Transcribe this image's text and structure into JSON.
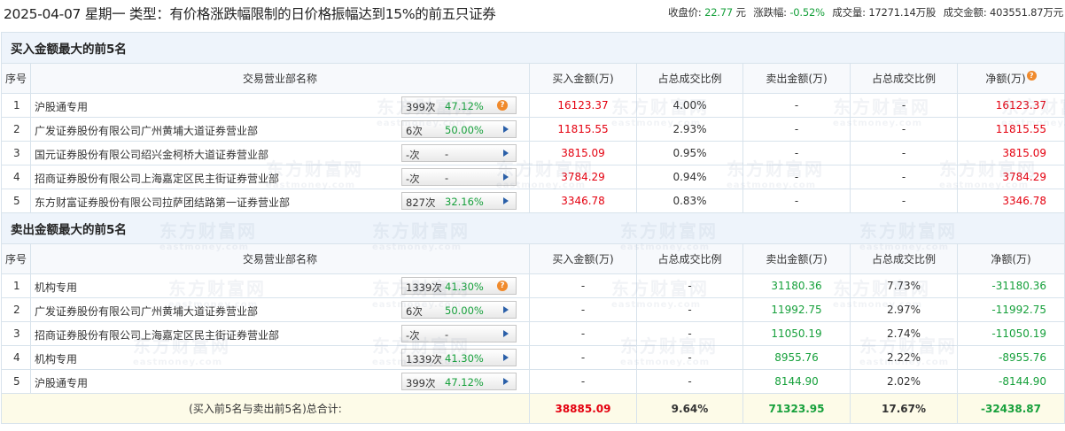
{
  "header": {
    "title": "2025-04-07 星期一 类型：有价格涨跌幅限制的日价格振幅达到15%的前五只证券",
    "close_label": "收盘价:",
    "close_value": "22.77",
    "close_unit": "元",
    "change_label": "涨跌幅:",
    "change_value": "-0.52%",
    "volume_label": "成交量:",
    "volume_value": "17271.14万股",
    "amount_label": "成交金额:",
    "amount_value": "403551.87万元"
  },
  "buy_section": {
    "title": "买入金额最大的前5名",
    "columns": [
      "序号",
      "交易营业部名称",
      "买入金额(万)",
      "占总成交比例",
      "卖出金额(万)",
      "占总成交比例",
      "净额(万)"
    ],
    "rows": [
      {
        "idx": "1",
        "name": "沪股通专用",
        "count": "399次",
        "pct": "47.12%",
        "buy": "16123.37",
        "buy_ratio": "4.00%",
        "sell": "-",
        "sell_ratio": "-",
        "net": "16123.37",
        "icon": "question-icon"
      },
      {
        "idx": "2",
        "name": "广发证券股份有限公司广州黄埔大道证券营业部",
        "count": "6次",
        "pct": "50.00%",
        "buy": "11815.55",
        "buy_ratio": "2.93%",
        "sell": "-",
        "sell_ratio": "-",
        "net": "11815.55",
        "icon": "arrow-right-icon"
      },
      {
        "idx": "3",
        "name": "国元证券股份有限公司绍兴金柯桥大道证券营业部",
        "count": "-次",
        "pct": "-",
        "buy": "3815.09",
        "buy_ratio": "0.95%",
        "sell": "-",
        "sell_ratio": "-",
        "net": "3815.09",
        "icon": "arrow-right-icon"
      },
      {
        "idx": "4",
        "name": "招商证券股份有限公司上海嘉定区民主街证券营业部",
        "count": "-次",
        "pct": "-",
        "buy": "3784.29",
        "buy_ratio": "0.94%",
        "sell": "-",
        "sell_ratio": "-",
        "net": "3784.29",
        "icon": "arrow-right-icon"
      },
      {
        "idx": "5",
        "name": "东方财富证券股份有限公司拉萨团结路第一证券营业部",
        "count": "827次",
        "pct": "32.16%",
        "buy": "3346.78",
        "buy_ratio": "0.83%",
        "sell": "-",
        "sell_ratio": "-",
        "net": "3346.78",
        "icon": "arrow-right-icon"
      }
    ]
  },
  "sell_section": {
    "title": "卖出金额最大的前5名",
    "columns": [
      "序号",
      "交易营业部名称",
      "买入金额(万)",
      "占总成交比例",
      "卖出金额(万)",
      "占总成交比例",
      "净额(万)"
    ],
    "rows": [
      {
        "idx": "1",
        "name": "机构专用",
        "count": "1339次",
        "pct": "41.30%",
        "buy": "-",
        "buy_ratio": "-",
        "sell": "31180.36",
        "sell_ratio": "7.73%",
        "net": "-31180.36",
        "icon": "question-icon"
      },
      {
        "idx": "2",
        "name": "广发证券股份有限公司广州黄埔大道证券营业部",
        "count": "6次",
        "pct": "50.00%",
        "buy": "-",
        "buy_ratio": "-",
        "sell": "11992.75",
        "sell_ratio": "2.97%",
        "net": "-11992.75",
        "icon": "arrow-right-icon"
      },
      {
        "idx": "3",
        "name": "招商证券股份有限公司上海嘉定区民主街证券营业部",
        "count": "-次",
        "pct": "-",
        "buy": "-",
        "buy_ratio": "-",
        "sell": "11050.19",
        "sell_ratio": "2.74%",
        "net": "-11050.19",
        "icon": "arrow-right-icon"
      },
      {
        "idx": "4",
        "name": "机构专用",
        "count": "1339次",
        "pct": "41.30%",
        "buy": "-",
        "buy_ratio": "-",
        "sell": "8955.76",
        "sell_ratio": "2.22%",
        "net": "-8955.76",
        "icon": "arrow-right-icon"
      },
      {
        "idx": "5",
        "name": "沪股通专用",
        "count": "399次",
        "pct": "47.12%",
        "buy": "-",
        "buy_ratio": "-",
        "sell": "8144.90",
        "sell_ratio": "2.02%",
        "net": "-8144.90",
        "icon": "arrow-right-icon"
      }
    ]
  },
  "total": {
    "label": "(买入前5名与卖出前5名)总合计:",
    "buy": "38885.09",
    "buy_ratio": "9.64%",
    "sell": "71323.95",
    "sell_ratio": "17.67%",
    "net": "-32438.87"
  },
  "watermark": {
    "cn": "东方财富网",
    "en": "eastmoney.com"
  },
  "colors": {
    "positive": "#e4000f",
    "negative": "#16a03b",
    "section_bg": "#eef4fb",
    "total_bg": "#fdfbe8",
    "border": "#d8e3ec"
  }
}
